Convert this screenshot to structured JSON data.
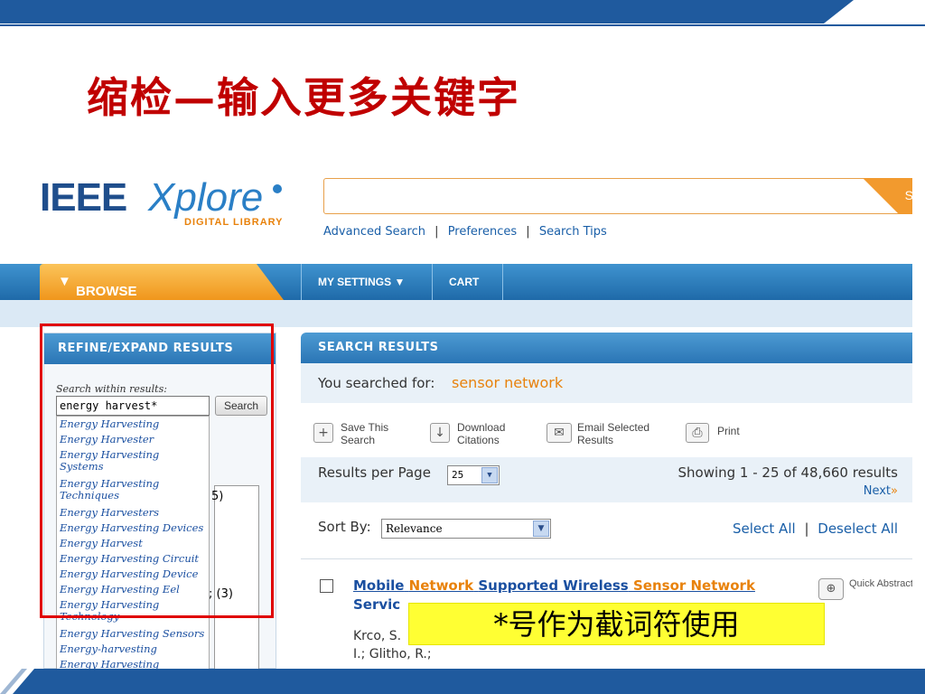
{
  "slide": {
    "title": "缩检—输入更多关键字",
    "callout": "*号作为截词符使用",
    "colors": {
      "title": "#c00000",
      "band": "#1f5a9e",
      "callout_bg": "#ffff33",
      "highlight_box": "#e00000"
    }
  },
  "header": {
    "logo_ieee": "IEEE",
    "logo_xplore": "Xplore",
    "logo_sub": "DIGITAL LIBRARY",
    "search_button_label": "S",
    "links": [
      "Advanced Search",
      "Preferences",
      "Search Tips"
    ],
    "link_separator": "|"
  },
  "nav": {
    "browse": "BROWSE",
    "items": [
      "MY SETTINGS",
      "CART"
    ],
    "dropdown_icon": "chevron-down-icon"
  },
  "refine": {
    "title": "REFINE/EXPAND RESULTS",
    "within_label": "Search within results:",
    "within_value": "energy harvest*",
    "search_button": "Search",
    "suggestions": [
      "Energy Harvesting",
      "Energy Harvester",
      "Energy Harvesting Systems",
      "Energy Harvesting Techniques",
      "Energy Harvesters",
      "Energy Harvesting Devices",
      "Energy Harvest",
      "Energy Harvesting Circuit",
      "Energy Harvesting Device",
      "Energy Harvesting Eel",
      "Energy Harvesting Technology",
      "Energy Harvesting Sensors",
      "Energy-harvesting",
      "Energy Harvesting"
    ],
    "background_counts": [
      "5)",
      "; (3)"
    ]
  },
  "results": {
    "title": "SEARCH RESULTS",
    "searched_label": "You searched for:",
    "searched_term": "sensor network",
    "actions": [
      {
        "label": "Save This Search",
        "icon": "plus-icon"
      },
      {
        "label": "Download Citations",
        "icon": "download-icon"
      },
      {
        "label": "Email Selected Results",
        "icon": "email-icon"
      },
      {
        "label": "Print",
        "icon": "printer-icon"
      }
    ],
    "rpp_label": "Results per Page",
    "rpp_value": "25",
    "showing": "Showing 1 - 25 of 48,660 results",
    "next": "Next",
    "sort_label": "Sort By:",
    "sort_value": "Relevance",
    "select_all": "Select All",
    "deselect_all": "Deselect All",
    "first": {
      "title_part1": "Mobile",
      "title_part2": "Network",
      "title_part3": "Supported Wireless",
      "title_part4": "Sensor Network",
      "title_line2": "Servic",
      "authors_line1": "Krco, S.",
      "authors_line2": "I.; Glitho, R.;",
      "quick_label": "Quick Abstract"
    }
  }
}
